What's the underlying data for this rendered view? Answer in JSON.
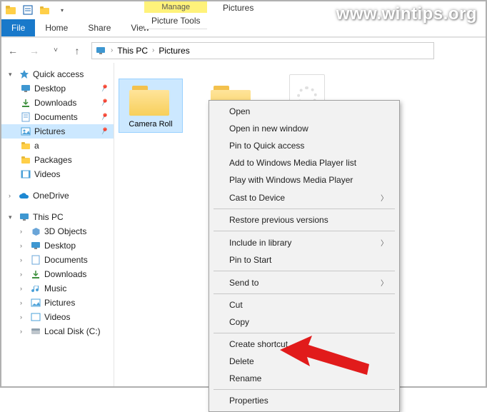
{
  "watermark": "www.wintips.org",
  "window_title": "Pictures",
  "ribbon": {
    "file": "File",
    "tabs": [
      "Home",
      "Share",
      "View"
    ],
    "contextual_header": "Manage",
    "contextual_tab": "Picture Tools"
  },
  "nav": {
    "back": "←",
    "forward": "→",
    "up": "↑",
    "recent": "˅"
  },
  "breadcrumb": {
    "root_icon": "monitor",
    "parts": [
      "This PC",
      "Pictures"
    ]
  },
  "sidebar": {
    "quick_access": {
      "label": "Quick access",
      "expanded": true
    },
    "qa_items": [
      {
        "label": "Desktop",
        "icon": "desktop",
        "pinned": true
      },
      {
        "label": "Downloads",
        "icon": "downloads",
        "pinned": true
      },
      {
        "label": "Documents",
        "icon": "documents",
        "pinned": true
      },
      {
        "label": "Pictures",
        "icon": "pictures",
        "pinned": true,
        "selected": true
      },
      {
        "label": "a",
        "icon": "folder",
        "pinned": false
      },
      {
        "label": "Packages",
        "icon": "folder",
        "pinned": false
      },
      {
        "label": "Videos",
        "icon": "videos",
        "pinned": false
      }
    ],
    "onedrive": {
      "label": "OneDrive"
    },
    "thispc": {
      "label": "This PC",
      "expanded": true
    },
    "pc_items": [
      {
        "label": "3D Objects",
        "icon": "3d"
      },
      {
        "label": "Desktop",
        "icon": "desktop"
      },
      {
        "label": "Documents",
        "icon": "documents"
      },
      {
        "label": "Downloads",
        "icon": "downloads"
      },
      {
        "label": "Music",
        "icon": "music"
      },
      {
        "label": "Pictures",
        "icon": "pictures"
      },
      {
        "label": "Videos",
        "icon": "videos"
      },
      {
        "label": "Local Disk (C:)",
        "icon": "disk"
      }
    ]
  },
  "content": {
    "items": [
      {
        "label": "Camera Roll",
        "type": "folder",
        "selected": true
      },
      {
        "label": "",
        "type": "folder",
        "selected": false
      },
      {
        "label": "",
        "type": "file",
        "selected": false
      }
    ]
  },
  "context_menu": {
    "groups": [
      [
        "Open",
        "Open in new window",
        "Pin to Quick access",
        "Add to Windows Media Player list",
        "Play with Windows Media Player"
      ],
      [
        {
          "label": "Cast to Device",
          "submenu": true
        }
      ],
      [
        "Restore previous versions"
      ],
      [
        {
          "label": "Include in library",
          "submenu": true
        },
        "Pin to Start"
      ],
      [
        {
          "label": "Send to",
          "submenu": true
        }
      ],
      [
        "Cut",
        "Copy"
      ],
      [
        "Create shortcut",
        "Delete",
        "Rename"
      ],
      [
        "Properties"
      ]
    ]
  }
}
